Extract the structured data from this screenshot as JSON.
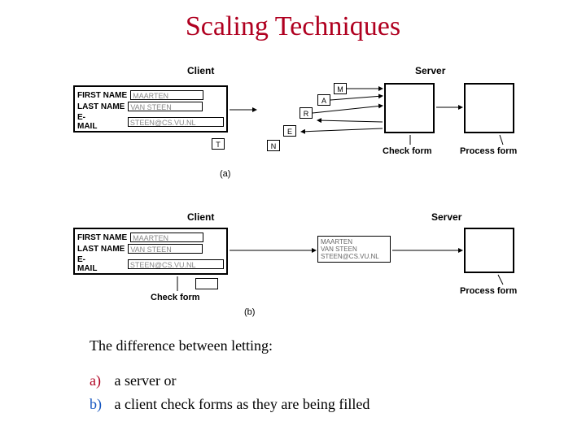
{
  "title": "Scaling Techniques",
  "form": {
    "labels": {
      "first": "FIRST NAME",
      "last": "LAST NAME",
      "email": "E-MAIL"
    },
    "values": {
      "first": "MAARTEN",
      "last": "VAN STEEN",
      "email": "STEEN@CS.VU.NL"
    }
  },
  "letterBoxesA": {
    "m": "M",
    "a": "A",
    "r": "R",
    "e": "E",
    "n": "N",
    "t": "T"
  },
  "headings": {
    "client": "Client",
    "server": "Server"
  },
  "boxLabels": {
    "check": "Check form",
    "process": "Process form"
  },
  "captions": {
    "a": "(a)",
    "b": "(b)"
  },
  "bottom": {
    "intro": "The difference between letting:",
    "a_marker": "a)",
    "a_text": "a server or",
    "b_marker": "b)",
    "b_text": "a client check forms as they are being filled"
  }
}
